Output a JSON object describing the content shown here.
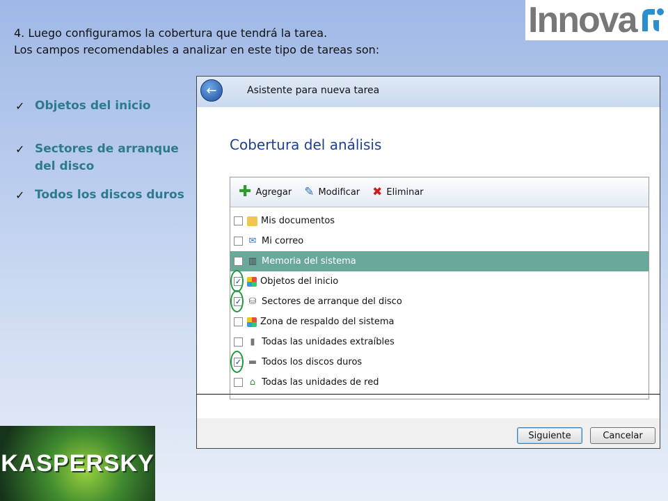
{
  "intro": {
    "line1": "4. Luego configuramos la cobertura que tendrá la tarea.",
    "line2": "Los campos recomendables a analizar en este tipo de tareas son:"
  },
  "logo": {
    "text": "Innova",
    "color": "#777777",
    "mark_color": "#2a8fd0"
  },
  "checklist": [
    {
      "label": "Objetos del inicio"
    },
    {
      "label": "Sectores de arranque",
      "label2": "del disco"
    },
    {
      "label": "Todos los discos duros"
    }
  ],
  "dialog": {
    "title": "Asistente para nueva tarea",
    "section_title": "Cobertura del análisis",
    "toolbar": {
      "add": "Agregar",
      "edit": "Modificar",
      "delete": "Eliminar"
    },
    "items": [
      {
        "label": "Mis documentos",
        "checked": false,
        "icon": "folder-icon"
      },
      {
        "label": "Mi correo",
        "checked": false,
        "icon": "mail-icon"
      },
      {
        "label": "Memoria del sistema",
        "checked": false,
        "icon": "memory-chip-icon",
        "selected": true
      },
      {
        "label": "Objetos del inicio",
        "checked": true,
        "icon": "windows-icon",
        "highlighted": true
      },
      {
        "label": "Sectores de arranque del disco",
        "checked": true,
        "icon": "boot-sector-icon",
        "highlighted": true
      },
      {
        "label": "Zona de respaldo del sistema",
        "checked": false,
        "icon": "windows-icon"
      },
      {
        "label": "Todas las unidades extraíbles",
        "checked": false,
        "icon": "removable-drive-icon"
      },
      {
        "label": "Todos los discos duros",
        "checked": true,
        "icon": "hard-drive-icon",
        "highlighted": true
      },
      {
        "label": "Todas las unidades de red",
        "checked": false,
        "icon": "network-drive-icon"
      }
    ],
    "buttons": {
      "next": "Siguiente",
      "cancel": "Cancelar"
    }
  },
  "brand": {
    "kaspersky": "KASPERSKY"
  },
  "colors": {
    "accent_text": "#2c7a8c",
    "selected_row": "#6aa89b",
    "highlight_oval": "#1f9a3e"
  }
}
